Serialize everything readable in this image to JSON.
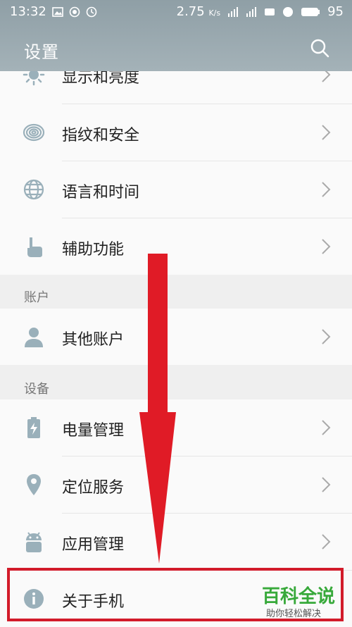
{
  "status": {
    "time": "13:32",
    "speed": "2.75",
    "speed_unit": "K/s",
    "battery": "95"
  },
  "header": {
    "title": "设置",
    "search_icon": "search-icon"
  },
  "rows": [
    {
      "label": "显示和亮度",
      "icon": "brightness-icon"
    },
    {
      "label": "指纹和安全",
      "icon": "fingerprint-icon"
    },
    {
      "label": "语言和时间",
      "icon": "globe-icon"
    },
    {
      "label": "辅助功能",
      "icon": "hand-icon"
    }
  ],
  "sections": [
    {
      "title": "账户"
    },
    {
      "title": "设备"
    }
  ],
  "account_rows": [
    {
      "label": "其他账户",
      "icon": "person-icon"
    }
  ],
  "device_rows": [
    {
      "label": "电量管理",
      "icon": "battery-icon"
    },
    {
      "label": "定位服务",
      "icon": "location-icon"
    },
    {
      "label": "应用管理",
      "icon": "android-icon"
    },
    {
      "label": "关于手机",
      "icon": "info-icon"
    }
  ],
  "watermark": {
    "brand": "百科全说",
    "slogan": "助你轻松解决"
  },
  "colors": {
    "header": "#9aa9b0",
    "accent_icon": "#9ab0ba",
    "annotation": "#d21b2a",
    "watermark": "#37a93a"
  }
}
